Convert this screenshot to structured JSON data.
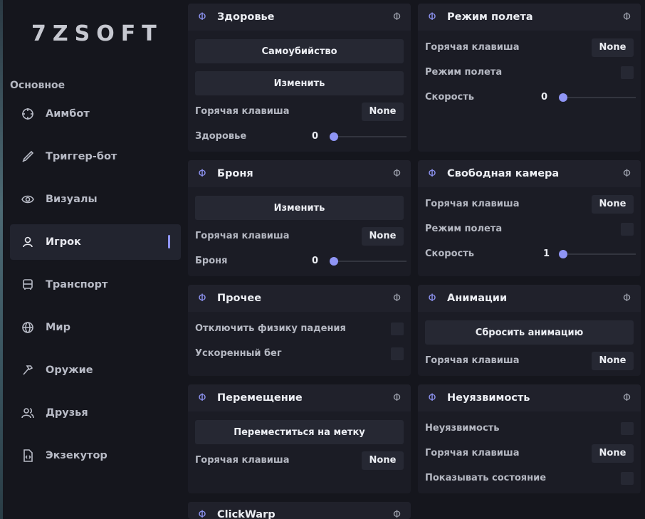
{
  "brand": "7ZSOFT",
  "accent": "#8f95f5",
  "sidebar": {
    "section": "Основное",
    "items": [
      {
        "label": "Аимбот",
        "icon": "crosshair-icon"
      },
      {
        "label": "Триггер-бот",
        "icon": "pen-icon"
      },
      {
        "label": "Визуалы",
        "icon": "eye-icon"
      },
      {
        "label": "Игрок",
        "icon": "user-icon",
        "active": true
      },
      {
        "label": "Транспорт",
        "icon": "car-icon"
      },
      {
        "label": "Мир",
        "icon": "globe-icon"
      },
      {
        "label": "Оружие",
        "icon": "hammer-icon"
      },
      {
        "label": "Друзья",
        "icon": "users-icon"
      },
      {
        "label": "Экзекутор",
        "icon": "code-file-icon"
      }
    ]
  },
  "panels": {
    "health": {
      "phi": "Φ",
      "title": "Здоровье",
      "suicide_button": "Самоубийство",
      "change_button": "Изменить",
      "hotkey_label": "Горячая клавиша",
      "hotkey_value": "None",
      "slider_label": "Здоровье",
      "slider_value": "0",
      "slider_fraction": 0
    },
    "armor": {
      "title": "Броня",
      "change_button": "Изменить",
      "hotkey_label": "Горячая клавиша",
      "hotkey_value": "None",
      "slider_label": "Броня",
      "slider_value": "0",
      "slider_fraction": 0
    },
    "misc": {
      "title": "Прочее",
      "disable_fall_label": "Отключить физику падения",
      "fast_run_label": "Ускоренный бег"
    },
    "teleport": {
      "title": "Перемещение",
      "teleport_button": "Переместиться на метку",
      "hotkey_label": "Горячая клавиша",
      "hotkey_value": "None"
    },
    "clickwarp": {
      "title": "ClickWarp"
    },
    "flight": {
      "title": "Режим полета",
      "hotkey_label": "Горячая клавиша",
      "hotkey_value": "None",
      "mode_label": "Режим полета",
      "speed_label": "Скорость",
      "speed_value": "0",
      "speed_fraction": 0
    },
    "freecam": {
      "title": "Свободная камера",
      "hotkey_label": "Горячая клавиша",
      "hotkey_value": "None",
      "mode_label": "Режим полета",
      "speed_label": "Скорость",
      "speed_value": "1",
      "speed_fraction": 0
    },
    "animations": {
      "title": "Анимации",
      "reset_button": "Сбросить анимацию",
      "hotkey_label": "Горячая клавиша",
      "hotkey_value": "None"
    },
    "godmode": {
      "title": "Неуязвимость",
      "godmode_label": "Неуязвимость",
      "hotkey_label": "Горячая клавиша",
      "hotkey_value": "None",
      "show_state_label": "Показывать состояние"
    }
  }
}
